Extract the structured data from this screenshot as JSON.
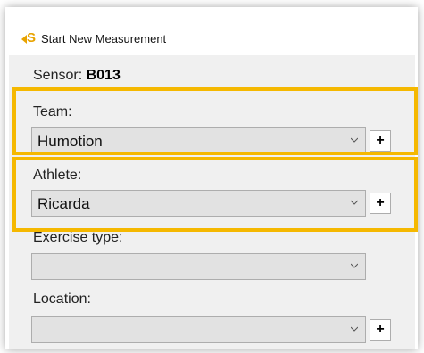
{
  "window": {
    "title": "Start New Measurement",
    "logo_icon": "smartabase-logo-icon"
  },
  "sensor": {
    "label": "Sensor:",
    "value": "B013"
  },
  "team": {
    "label": "Team:",
    "value": "Humotion",
    "add_label": "+"
  },
  "athlete": {
    "label": "Athlete:",
    "value": "Ricarda",
    "add_label": "+"
  },
  "exercise": {
    "label": "Exercise type:",
    "value": ""
  },
  "location": {
    "label": "Location:",
    "value": "",
    "add_label": "+"
  },
  "colors": {
    "highlight": "#f5b800",
    "logo": "#e8a300",
    "panel": "#f0f0f0"
  }
}
